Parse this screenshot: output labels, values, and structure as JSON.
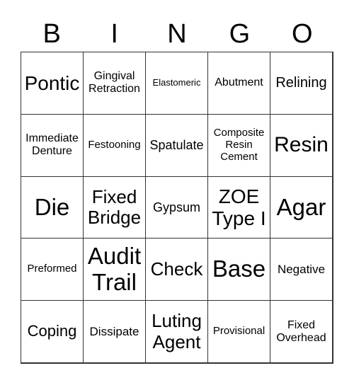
{
  "header": [
    "B",
    "I",
    "N",
    "G",
    "O"
  ],
  "cells": [
    "Pontic",
    "Gingival Retraction",
    "Elastomeric",
    "Abutment",
    "Relining",
    "Immediate Denture",
    "Festooning",
    "Spatulate",
    "Composite Resin Cement",
    "Resin",
    "Die",
    "Fixed Bridge",
    "Gypsum",
    "ZOE Type I",
    "Agar",
    "Preformed",
    "Audit Trail",
    "Check",
    "Base",
    "Negative",
    "Coping",
    "Dissipate",
    "Luting Agent",
    "Provisional",
    "Fixed Overhead"
  ]
}
